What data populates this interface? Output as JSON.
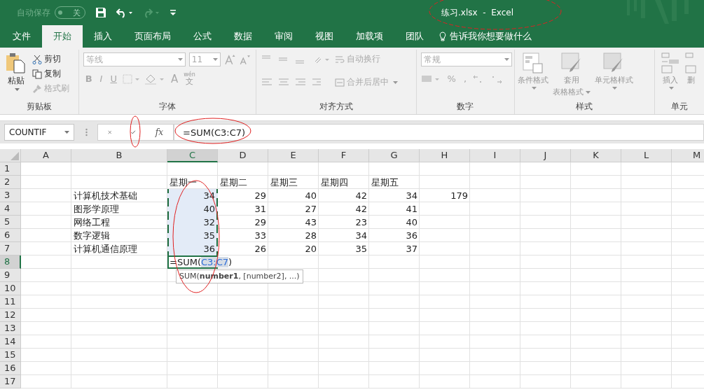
{
  "title_bar": {
    "autosave_label": "自动保存",
    "autosave_toggle": {
      "label": "关",
      "on": false
    },
    "title": "练习.xlsx  -  Excel"
  },
  "tabs": [
    {
      "label": "文件",
      "selected": false
    },
    {
      "label": "开始",
      "selected": true
    },
    {
      "label": "插入",
      "selected": false
    },
    {
      "label": "页面布局",
      "selected": false
    },
    {
      "label": "公式",
      "selected": false
    },
    {
      "label": "数据",
      "selected": false
    },
    {
      "label": "审阅",
      "selected": false
    },
    {
      "label": "视图",
      "selected": false
    },
    {
      "label": "加载项",
      "selected": false
    },
    {
      "label": "团队",
      "selected": false
    }
  ],
  "tell_me": "告诉我你想要做什么",
  "ribbon": {
    "clipboard": {
      "paste": "粘贴",
      "cut": "剪切",
      "copy": "复制",
      "format_painter": "格式刷",
      "label": "剪贴板"
    },
    "font": {
      "font_name": "等线",
      "font_size": "11",
      "bold": "B",
      "italic": "I",
      "underline": "U",
      "font_color": "A",
      "phonetic_top": "wén",
      "phonetic_bottom": "文",
      "label": "字体"
    },
    "alignment": {
      "wrap": "自动换行",
      "merge": "合并后居中",
      "label": "对齐方式"
    },
    "number": {
      "format": "常规",
      "percent": "%",
      "comma": ",",
      "label": "数字"
    },
    "styles": {
      "conditional": "条件格式",
      "table_top": "套用",
      "table_bottom": "表格格式",
      "cell_styles": "单元格样式",
      "label": "样式"
    },
    "cells": {
      "insert": "插入",
      "delete": "删",
      "label": "单元"
    }
  },
  "formula_bar": {
    "name_box": "COUNTIF",
    "fx": "fx",
    "formula": "=SUM(C3:C7)"
  },
  "sheet": {
    "columns": [
      {
        "label": "A",
        "selected": false
      },
      {
        "label": "B",
        "selected": false
      },
      {
        "label": "C",
        "selected": true
      },
      {
        "label": "D",
        "selected": false
      },
      {
        "label": "E",
        "selected": false
      },
      {
        "label": "F",
        "selected": false
      },
      {
        "label": "G",
        "selected": false
      },
      {
        "label": "H",
        "selected": false
      },
      {
        "label": "I",
        "selected": false
      },
      {
        "label": "J",
        "selected": false
      },
      {
        "label": "K",
        "selected": false
      },
      {
        "label": "L",
        "selected": false
      },
      {
        "label": "M",
        "selected": false
      }
    ],
    "rows": [
      {
        "header": "1",
        "selected": false,
        "cells": {}
      },
      {
        "header": "2",
        "selected": false,
        "cells": {
          "C": {
            "text": "星期一",
            "kind": "text",
            "in_range": false
          },
          "D": {
            "text": "星期二",
            "kind": "text",
            "in_range": false
          },
          "E": {
            "text": "星期三",
            "kind": "text",
            "in_range": false
          },
          "F": {
            "text": "星期四",
            "kind": "text",
            "in_range": false
          },
          "G": {
            "text": "星期五",
            "kind": "text",
            "in_range": false
          }
        }
      },
      {
        "header": "3",
        "selected": false,
        "cells": {
          "B": {
            "text": "计算机技术基础",
            "kind": "text",
            "in_range": false
          },
          "C": {
            "text": "34",
            "kind": "number",
            "in_range": true
          },
          "D": {
            "text": "29",
            "kind": "number",
            "in_range": false
          },
          "E": {
            "text": "40",
            "kind": "number",
            "in_range": false
          },
          "F": {
            "text": "42",
            "kind": "number",
            "in_range": false
          },
          "G": {
            "text": "34",
            "kind": "number",
            "in_range": false
          },
          "H": {
            "text": "179",
            "kind": "number",
            "in_range": false
          }
        }
      },
      {
        "header": "4",
        "selected": false,
        "cells": {
          "B": {
            "text": "图形学原理",
            "kind": "text",
            "in_range": false
          },
          "C": {
            "text": "40",
            "kind": "number",
            "in_range": true
          },
          "D": {
            "text": "31",
            "kind": "number",
            "in_range": false
          },
          "E": {
            "text": "27",
            "kind": "number",
            "in_range": false
          },
          "F": {
            "text": "42",
            "kind": "number",
            "in_range": false
          },
          "G": {
            "text": "41",
            "kind": "number",
            "in_range": false
          }
        }
      },
      {
        "header": "5",
        "selected": false,
        "cells": {
          "B": {
            "text": "网络工程",
            "kind": "text",
            "in_range": false
          },
          "C": {
            "text": "32",
            "kind": "number",
            "in_range": true
          },
          "D": {
            "text": "29",
            "kind": "number",
            "in_range": false
          },
          "E": {
            "text": "43",
            "kind": "number",
            "in_range": false
          },
          "F": {
            "text": "23",
            "kind": "number",
            "in_range": false
          },
          "G": {
            "text": "40",
            "kind": "number",
            "in_range": false
          }
        }
      },
      {
        "header": "6",
        "selected": false,
        "cells": {
          "B": {
            "text": "数字逻辑",
            "kind": "text",
            "in_range": false
          },
          "C": {
            "text": "35",
            "kind": "number",
            "in_range": true
          },
          "D": {
            "text": "33",
            "kind": "number",
            "in_range": false
          },
          "E": {
            "text": "28",
            "kind": "number",
            "in_range": false
          },
          "F": {
            "text": "34",
            "kind": "number",
            "in_range": false
          },
          "G": {
            "text": "36",
            "kind": "number",
            "in_range": false
          }
        }
      },
      {
        "header": "7",
        "selected": false,
        "cells": {
          "B": {
            "text": "计算机通信原理",
            "kind": "text",
            "in_range": false
          },
          "C": {
            "text": "36",
            "kind": "number",
            "in_range": true
          },
          "D": {
            "text": "26",
            "kind": "number",
            "in_range": false
          },
          "E": {
            "text": "20",
            "kind": "number",
            "in_range": false
          },
          "F": {
            "text": "35",
            "kind": "number",
            "in_range": false
          },
          "G": {
            "text": "37",
            "kind": "number",
            "in_range": false
          }
        }
      },
      {
        "header": "8",
        "selected": true,
        "cells": {
          "C": {
            "kind": "editing",
            "prefix": "=SUM(",
            "ref": "C3:C7",
            "suffix": ")",
            "tooltip": "SUM(**number1**, [number2], ...)"
          }
        }
      },
      {
        "header": "9",
        "selected": false,
        "cells": {}
      },
      {
        "header": "10",
        "selected": false,
        "cells": {}
      },
      {
        "header": "11",
        "selected": false,
        "cells": {}
      },
      {
        "header": "12",
        "selected": false,
        "cells": {}
      },
      {
        "header": "13",
        "selected": false,
        "cells": {}
      },
      {
        "header": "14",
        "selected": false,
        "cells": {}
      },
      {
        "header": "15",
        "selected": false,
        "cells": {}
      },
      {
        "header": "16",
        "selected": false,
        "cells": {}
      },
      {
        "header": "17",
        "selected": false,
        "cells": {}
      }
    ]
  }
}
